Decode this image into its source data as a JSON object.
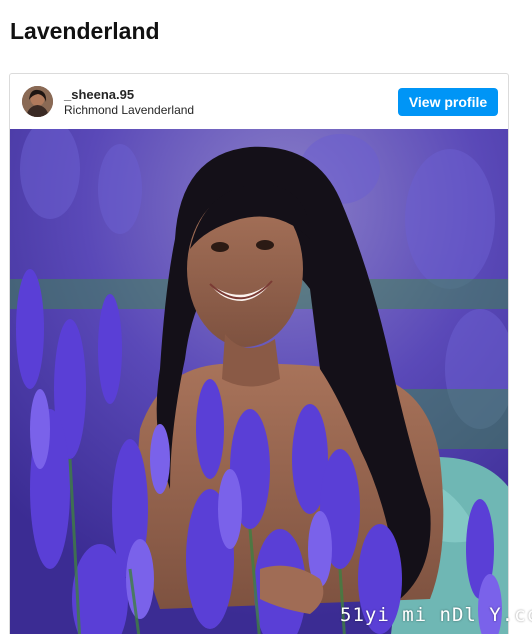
{
  "page": {
    "title": "Lavenderland"
  },
  "post": {
    "username": "_sheena.95",
    "location": "Richmond Lavenderland",
    "view_profile_label": "View profile",
    "photo_icon": "lavender-portrait-photo"
  },
  "watermark": {
    "text": "51yi mi nDl Y.cc"
  },
  "colors": {
    "button": "#0095f6",
    "border": "#dbdbdb",
    "lavender": "#5b3fd0"
  }
}
